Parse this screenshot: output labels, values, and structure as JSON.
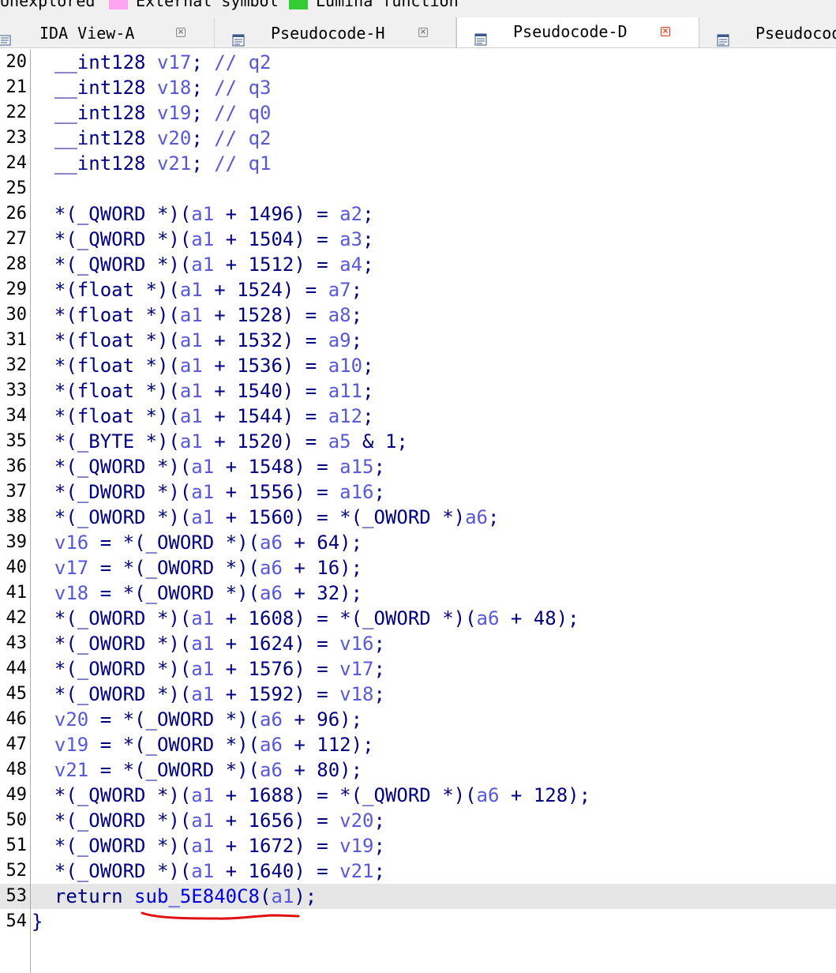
{
  "legend": {
    "items": [
      {
        "label": "Unexplored",
        "color": "#c8c8c8"
      },
      {
        "label": "External symbol",
        "color": "#ffa5f0"
      },
      {
        "label": "Lumina function",
        "color": "#33cc33"
      }
    ]
  },
  "tabs": [
    {
      "label": "IDA View-A",
      "active": false
    },
    {
      "label": "Pseudocode-H",
      "active": false
    },
    {
      "label": "Pseudocode-D",
      "active": true
    },
    {
      "label": "Pseudocode",
      "active": false
    }
  ],
  "code_lines": [
    {
      "num": "20",
      "tokens": [
        [
          "k",
          "  __int128 "
        ],
        [
          "v",
          "v17"
        ],
        [
          "k",
          "; "
        ],
        [
          "c",
          "// q2"
        ]
      ]
    },
    {
      "num": "21",
      "tokens": [
        [
          "k",
          "  __int128 "
        ],
        [
          "v",
          "v18"
        ],
        [
          "k",
          "; "
        ],
        [
          "c",
          "// q3"
        ]
      ]
    },
    {
      "num": "22",
      "tokens": [
        [
          "k",
          "  __int128 "
        ],
        [
          "v",
          "v19"
        ],
        [
          "k",
          "; "
        ],
        [
          "c",
          "// q0"
        ]
      ]
    },
    {
      "num": "23",
      "tokens": [
        [
          "k",
          "  __int128 "
        ],
        [
          "v",
          "v20"
        ],
        [
          "k",
          "; "
        ],
        [
          "c",
          "// q2"
        ]
      ]
    },
    {
      "num": "24",
      "tokens": [
        [
          "k",
          "  __int128 "
        ],
        [
          "v",
          "v21"
        ],
        [
          "k",
          "; "
        ],
        [
          "c",
          "// q1"
        ]
      ]
    },
    {
      "num": "25",
      "tokens": []
    },
    {
      "num": "26",
      "tokens": [
        [
          "k",
          "  *(_QWORD *)("
        ],
        [
          "v",
          "a1"
        ],
        [
          "k",
          " + 1496) = "
        ],
        [
          "v",
          "a2"
        ],
        [
          "k",
          ";"
        ]
      ]
    },
    {
      "num": "27",
      "tokens": [
        [
          "k",
          "  *(_QWORD *)("
        ],
        [
          "v",
          "a1"
        ],
        [
          "k",
          " + 1504) = "
        ],
        [
          "v",
          "a3"
        ],
        [
          "k",
          ";"
        ]
      ]
    },
    {
      "num": "28",
      "tokens": [
        [
          "k",
          "  *(_QWORD *)("
        ],
        [
          "v",
          "a1"
        ],
        [
          "k",
          " + 1512) = "
        ],
        [
          "v",
          "a4"
        ],
        [
          "k",
          ";"
        ]
      ]
    },
    {
      "num": "29",
      "tokens": [
        [
          "k",
          "  *(float *)("
        ],
        [
          "v",
          "a1"
        ],
        [
          "k",
          " + 1524) = "
        ],
        [
          "v",
          "a7"
        ],
        [
          "k",
          ";"
        ]
      ]
    },
    {
      "num": "30",
      "tokens": [
        [
          "k",
          "  *(float *)("
        ],
        [
          "v",
          "a1"
        ],
        [
          "k",
          " + 1528) = "
        ],
        [
          "v",
          "a8"
        ],
        [
          "k",
          ";"
        ]
      ]
    },
    {
      "num": "31",
      "tokens": [
        [
          "k",
          "  *(float *)("
        ],
        [
          "v",
          "a1"
        ],
        [
          "k",
          " + 1532) = "
        ],
        [
          "v",
          "a9"
        ],
        [
          "k",
          ";"
        ]
      ]
    },
    {
      "num": "32",
      "tokens": [
        [
          "k",
          "  *(float *)("
        ],
        [
          "v",
          "a1"
        ],
        [
          "k",
          " + 1536) = "
        ],
        [
          "v",
          "a10"
        ],
        [
          "k",
          ";"
        ]
      ]
    },
    {
      "num": "33",
      "tokens": [
        [
          "k",
          "  *(float *)("
        ],
        [
          "v",
          "a1"
        ],
        [
          "k",
          " + 1540) = "
        ],
        [
          "v",
          "a11"
        ],
        [
          "k",
          ";"
        ]
      ]
    },
    {
      "num": "34",
      "tokens": [
        [
          "k",
          "  *(float *)("
        ],
        [
          "v",
          "a1"
        ],
        [
          "k",
          " + 1544) = "
        ],
        [
          "v",
          "a12"
        ],
        [
          "k",
          ";"
        ]
      ]
    },
    {
      "num": "35",
      "tokens": [
        [
          "k",
          "  *(_BYTE *)("
        ],
        [
          "v",
          "a1"
        ],
        [
          "k",
          " + 1520) = "
        ],
        [
          "v",
          "a5"
        ],
        [
          "k",
          " & 1;"
        ]
      ]
    },
    {
      "num": "36",
      "tokens": [
        [
          "k",
          "  *(_QWORD *)("
        ],
        [
          "v",
          "a1"
        ],
        [
          "k",
          " + 1548) = "
        ],
        [
          "v",
          "a15"
        ],
        [
          "k",
          ";"
        ]
      ]
    },
    {
      "num": "37",
      "tokens": [
        [
          "k",
          "  *(_DWORD *)("
        ],
        [
          "v",
          "a1"
        ],
        [
          "k",
          " + 1556) = "
        ],
        [
          "v",
          "a16"
        ],
        [
          "k",
          ";"
        ]
      ]
    },
    {
      "num": "38",
      "tokens": [
        [
          "k",
          "  *(_OWORD *)("
        ],
        [
          "v",
          "a1"
        ],
        [
          "k",
          " + 1560) = *(_OWORD *)"
        ],
        [
          "v",
          "a6"
        ],
        [
          "k",
          ";"
        ]
      ]
    },
    {
      "num": "39",
      "tokens": [
        [
          "k",
          "  "
        ],
        [
          "v",
          "v16"
        ],
        [
          "k",
          " = *(_OWORD *)("
        ],
        [
          "v",
          "a6"
        ],
        [
          "k",
          " + 64);"
        ]
      ]
    },
    {
      "num": "40",
      "tokens": [
        [
          "k",
          "  "
        ],
        [
          "v",
          "v17"
        ],
        [
          "k",
          " = *(_OWORD *)("
        ],
        [
          "v",
          "a6"
        ],
        [
          "k",
          " + 16);"
        ]
      ]
    },
    {
      "num": "41",
      "tokens": [
        [
          "k",
          "  "
        ],
        [
          "v",
          "v18"
        ],
        [
          "k",
          " = *(_OWORD *)("
        ],
        [
          "v",
          "a6"
        ],
        [
          "k",
          " + 32);"
        ]
      ]
    },
    {
      "num": "42",
      "tokens": [
        [
          "k",
          "  *(_OWORD *)("
        ],
        [
          "v",
          "a1"
        ],
        [
          "k",
          " + 1608) = *(_OWORD *)("
        ],
        [
          "v",
          "a6"
        ],
        [
          "k",
          " + 48);"
        ]
      ]
    },
    {
      "num": "43",
      "tokens": [
        [
          "k",
          "  *(_OWORD *)("
        ],
        [
          "v",
          "a1"
        ],
        [
          "k",
          " + 1624) = "
        ],
        [
          "v",
          "v16"
        ],
        [
          "k",
          ";"
        ]
      ]
    },
    {
      "num": "44",
      "tokens": [
        [
          "k",
          "  *(_OWORD *)("
        ],
        [
          "v",
          "a1"
        ],
        [
          "k",
          " + 1576) = "
        ],
        [
          "v",
          "v17"
        ],
        [
          "k",
          ";"
        ]
      ]
    },
    {
      "num": "45",
      "tokens": [
        [
          "k",
          "  *(_OWORD *)("
        ],
        [
          "v",
          "a1"
        ],
        [
          "k",
          " + 1592) = "
        ],
        [
          "v",
          "v18"
        ],
        [
          "k",
          ";"
        ]
      ]
    },
    {
      "num": "46",
      "tokens": [
        [
          "k",
          "  "
        ],
        [
          "v",
          "v20"
        ],
        [
          "k",
          " = *(_OWORD *)("
        ],
        [
          "v",
          "a6"
        ],
        [
          "k",
          " + 96);"
        ]
      ]
    },
    {
      "num": "47",
      "tokens": [
        [
          "k",
          "  "
        ],
        [
          "v",
          "v19"
        ],
        [
          "k",
          " = *(_OWORD *)("
        ],
        [
          "v",
          "a6"
        ],
        [
          "k",
          " + 112);"
        ]
      ]
    },
    {
      "num": "48",
      "tokens": [
        [
          "k",
          "  "
        ],
        [
          "v",
          "v21"
        ],
        [
          "k",
          " = *(_OWORD *)("
        ],
        [
          "v",
          "a6"
        ],
        [
          "k",
          " + 80);"
        ]
      ]
    },
    {
      "num": "49",
      "tokens": [
        [
          "k",
          "  *(_QWORD *)("
        ],
        [
          "v",
          "a1"
        ],
        [
          "k",
          " + 1688) = *(_QWORD *)("
        ],
        [
          "v",
          "a6"
        ],
        [
          "k",
          " + 128);"
        ]
      ]
    },
    {
      "num": "50",
      "tokens": [
        [
          "k",
          "  *(_OWORD *)("
        ],
        [
          "v",
          "a1"
        ],
        [
          "k",
          " + 1656) = "
        ],
        [
          "v",
          "v20"
        ],
        [
          "k",
          ";"
        ]
      ]
    },
    {
      "num": "51",
      "tokens": [
        [
          "k",
          "  *(_OWORD *)("
        ],
        [
          "v",
          "a1"
        ],
        [
          "k",
          " + 1672) = "
        ],
        [
          "v",
          "v19"
        ],
        [
          "k",
          ";"
        ]
      ]
    },
    {
      "num": "52",
      "tokens": [
        [
          "k",
          "  *(_OWORD *)("
        ],
        [
          "v",
          "a1"
        ],
        [
          "k",
          " + 1640) = "
        ],
        [
          "v",
          "v21"
        ],
        [
          "k",
          ";"
        ]
      ]
    },
    {
      "num": "53",
      "highlight": true,
      "tokens": [
        [
          "k",
          "  return "
        ],
        [
          "f",
          "sub_5E840C8"
        ],
        [
          "k",
          "("
        ],
        [
          "v",
          "a1"
        ],
        [
          "k",
          ");"
        ]
      ]
    },
    {
      "num": "54",
      "tokens": [
        [
          "k",
          "}"
        ]
      ]
    }
  ],
  "annotation": {
    "color": "#e01010"
  }
}
